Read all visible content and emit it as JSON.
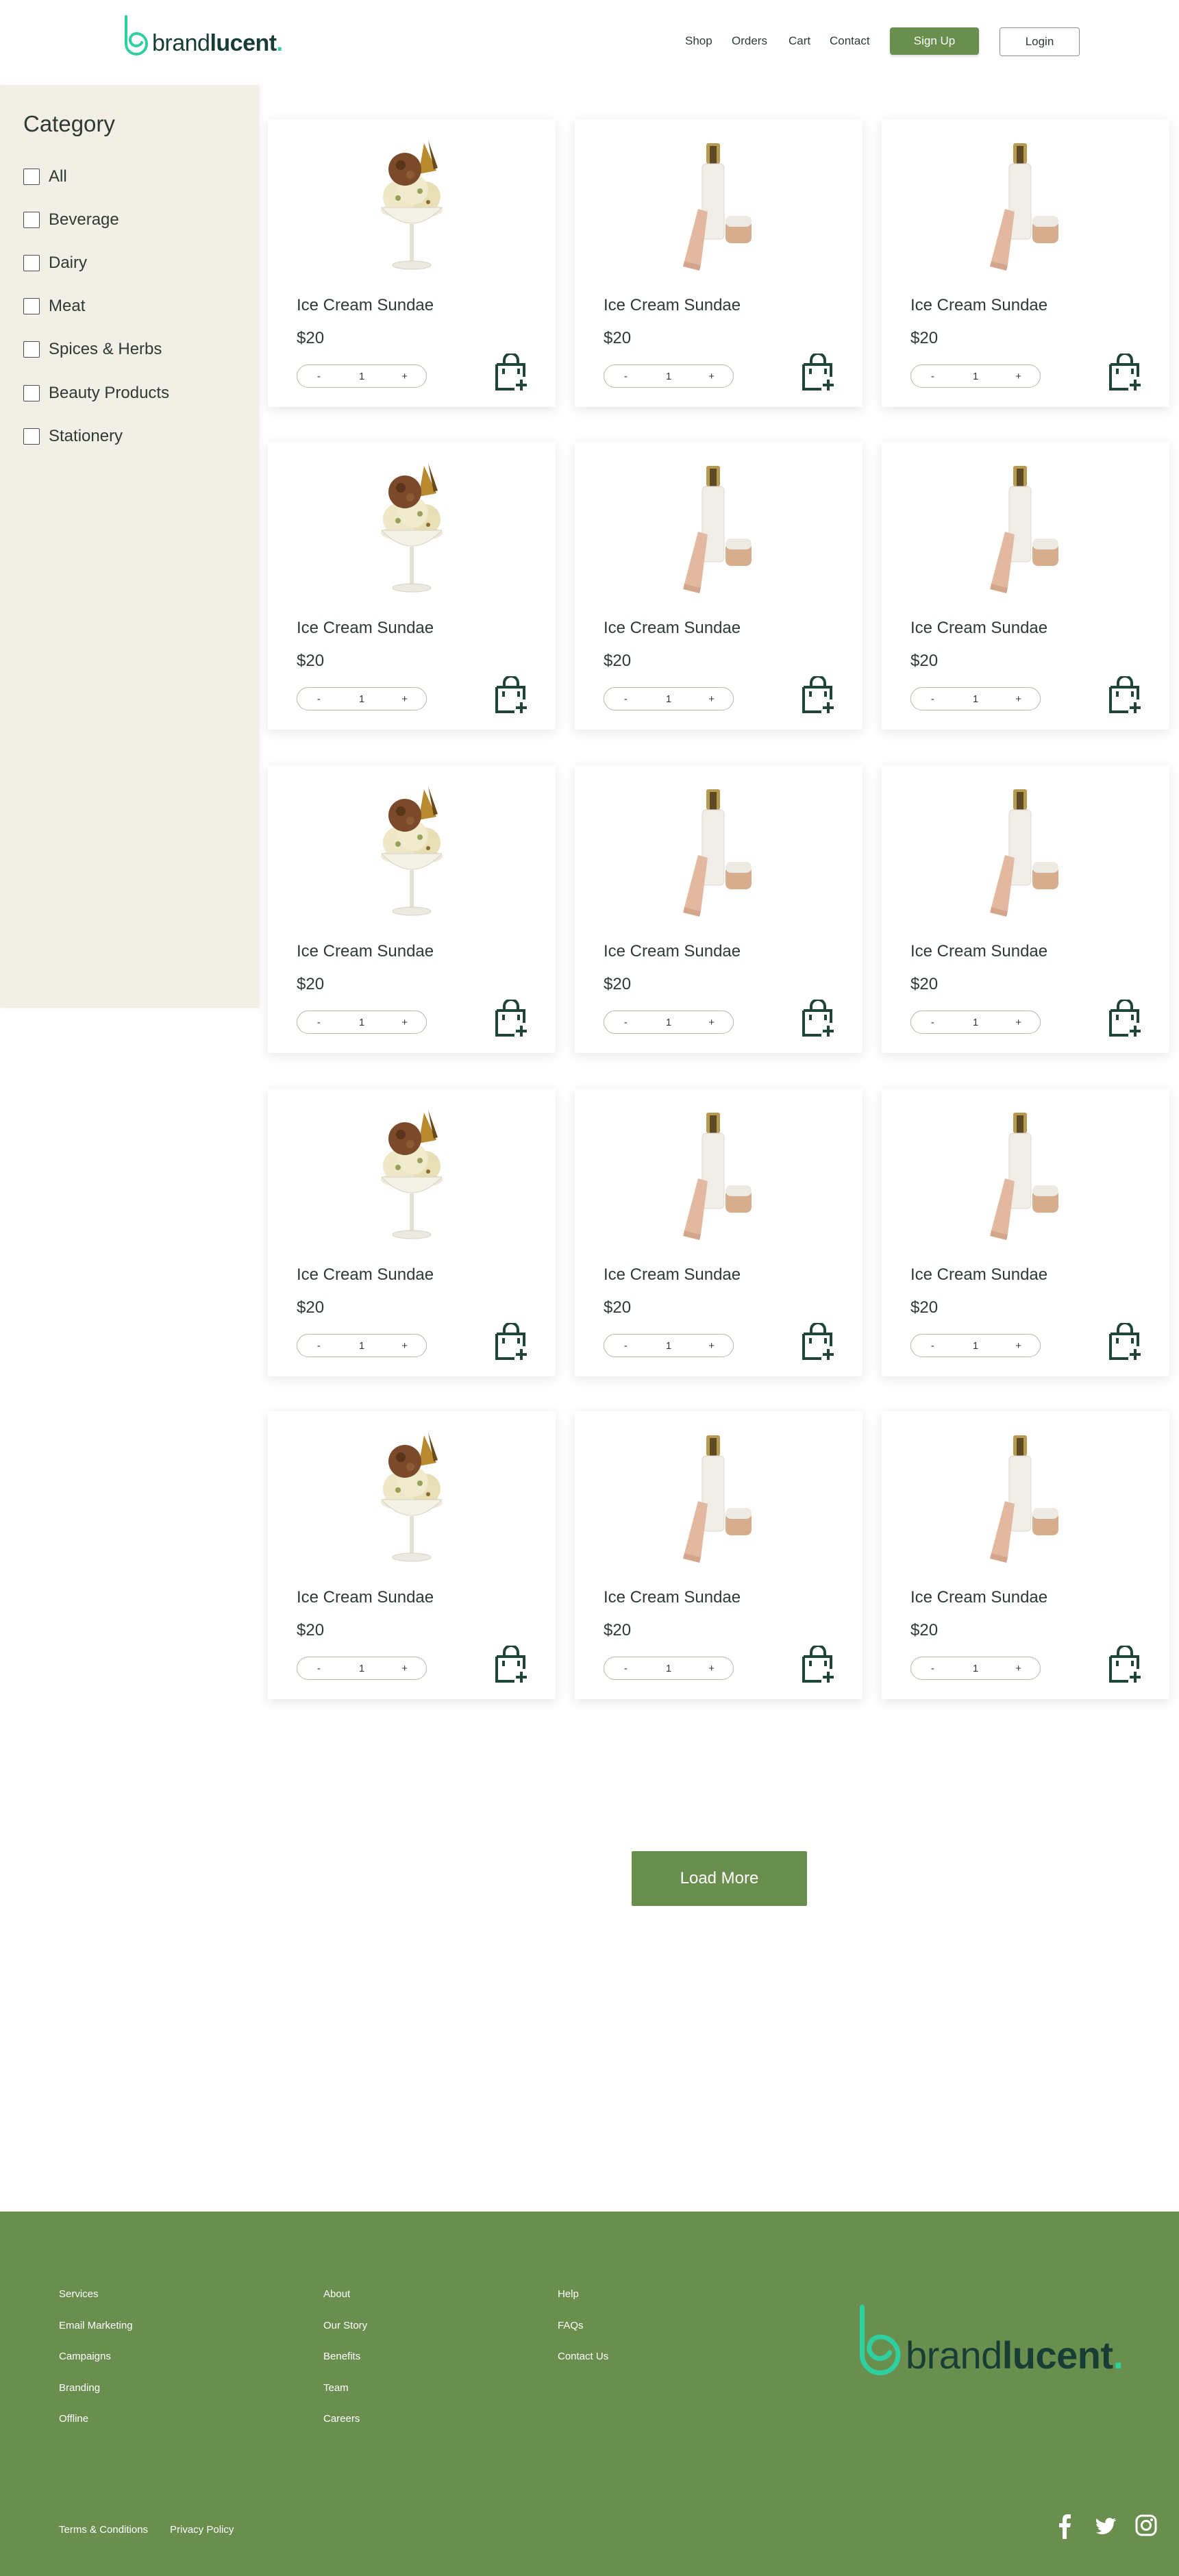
{
  "brand": {
    "name_light": "brand",
    "name_bold": "lucent",
    "name_dot": "."
  },
  "nav": {
    "items": [
      "Shop",
      "Orders",
      "Cart",
      "Contact"
    ],
    "signup_label": "Sign Up",
    "login_label": "Login"
  },
  "sidebar": {
    "title": "Category",
    "categories": [
      "All",
      "Beverage",
      "Dairy",
      "Meat",
      "Spices & Herbs",
      "Beauty Products",
      "Stationery"
    ]
  },
  "products": [
    {
      "name": "Ice Cream Sundae",
      "price": "$20",
      "qty": "1",
      "image": "sundae"
    },
    {
      "name": "Ice Cream Sundae",
      "price": "$20",
      "qty": "1",
      "image": "cosmetics"
    },
    {
      "name": "Ice Cream Sundae",
      "price": "$20",
      "qty": "1",
      "image": "cosmetics"
    },
    {
      "name": "Ice Cream Sundae",
      "price": "$20",
      "qty": "1",
      "image": "sundae"
    },
    {
      "name": "Ice Cream Sundae",
      "price": "$20",
      "qty": "1",
      "image": "cosmetics"
    },
    {
      "name": "Ice Cream Sundae",
      "price": "$20",
      "qty": "1",
      "image": "cosmetics"
    },
    {
      "name": "Ice Cream Sundae",
      "price": "$20",
      "qty": "1",
      "image": "sundae"
    },
    {
      "name": "Ice Cream Sundae",
      "price": "$20",
      "qty": "1",
      "image": "cosmetics"
    },
    {
      "name": "Ice Cream Sundae",
      "price": "$20",
      "qty": "1",
      "image": "cosmetics"
    },
    {
      "name": "Ice Cream Sundae",
      "price": "$20",
      "qty": "1",
      "image": "sundae"
    },
    {
      "name": "Ice Cream Sundae",
      "price": "$20",
      "qty": "1",
      "image": "cosmetics"
    },
    {
      "name": "Ice Cream Sundae",
      "price": "$20",
      "qty": "1",
      "image": "cosmetics"
    },
    {
      "name": "Ice Cream Sundae",
      "price": "$20",
      "qty": "1",
      "image": "sundae"
    },
    {
      "name": "Ice Cream Sundae",
      "price": "$20",
      "qty": "1",
      "image": "cosmetics"
    },
    {
      "name": "Ice Cream Sundae",
      "price": "$20",
      "qty": "1",
      "image": "cosmetics"
    }
  ],
  "qty_controls": {
    "minus": "-",
    "plus": "+"
  },
  "load_more_label": "Load More",
  "footer": {
    "col1": [
      "Services",
      "Email Marketing",
      "Campaigns",
      "Branding",
      "Offline"
    ],
    "col2": [
      "About",
      "Our Story",
      "Benefits",
      "Team",
      "Careers"
    ],
    "col3": [
      "Help",
      "FAQs",
      "Contact Us"
    ],
    "legal": [
      "Terms & Conditions",
      "Privacy Policy"
    ],
    "social": [
      "facebook-icon",
      "twitter-icon",
      "instagram-icon"
    ]
  },
  "colors": {
    "brand_green": "#6a8e4e",
    "logo_teal": "#2fd0a0",
    "logo_dark": "#173d35",
    "sidebar_bg": "#f2efe6",
    "icon_dark": "#1f4438"
  }
}
